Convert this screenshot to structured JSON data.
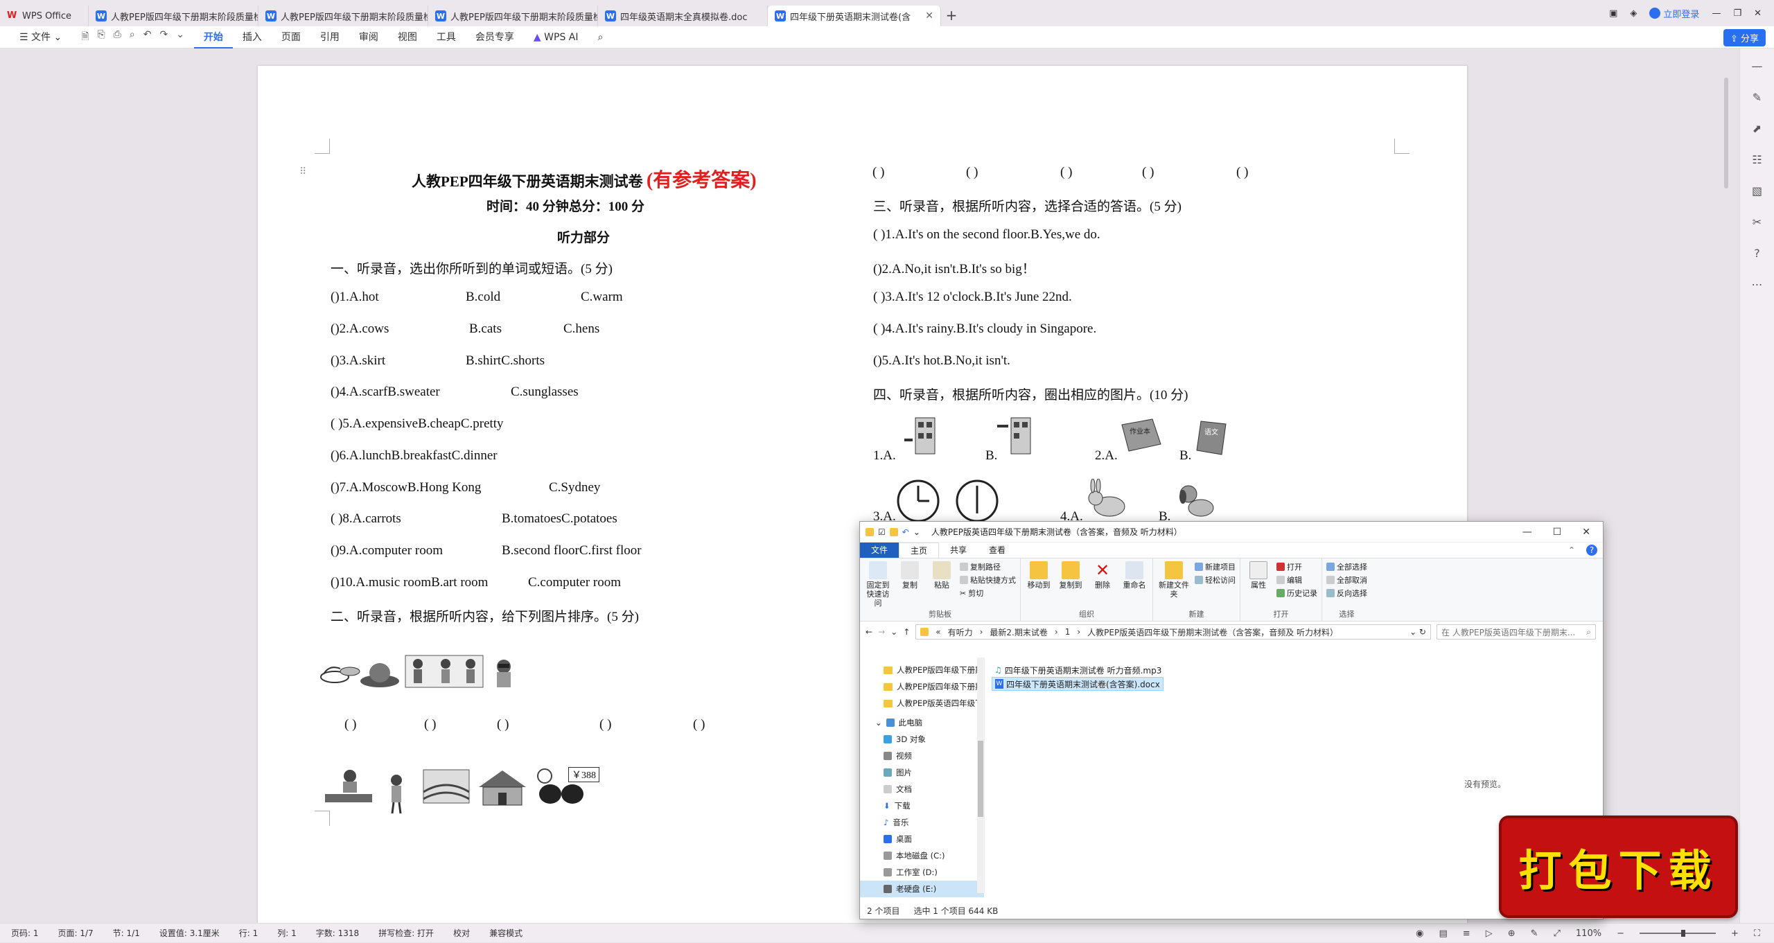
{
  "tabs": [
    {
      "label": "WPS Office",
      "kind": "wps"
    },
    {
      "label": "人教PEP版四年级下册期末阶段质量检",
      "kind": "doc"
    },
    {
      "label": "人教PEP版四年级下册期末阶段质量检",
      "kind": "doc"
    },
    {
      "label": "人教PEP版四年级下册期末阶段质量检",
      "kind": "doc"
    },
    {
      "label": "四年级英语期末全真模拟卷.doc",
      "kind": "doc"
    },
    {
      "label": "四年级下册英语期末测试卷(含",
      "kind": "doc",
      "active": true
    }
  ],
  "titlebar": {
    "login": "立即登录"
  },
  "menu": {
    "file": "文件",
    "items": [
      "开始",
      "插入",
      "页面",
      "引用",
      "审阅",
      "视图",
      "工具",
      "会员专享"
    ],
    "active": "开始",
    "ai": "WPS AI",
    "share": "分享"
  },
  "doc": {
    "title": "人教PEP四年级下册英语期末测试卷",
    "title_red": "(有参考答案)",
    "time": "时间：40 分钟总分：100 分",
    "section": "听力部分",
    "q1_head": "一、听录音，选出你所听到的单词或短语。(5 分)",
    "q1": [
      "()1.A.hot",
      "B.cold",
      "C.warm",
      "()2.A.cows",
      "B.cats",
      "C.hens",
      "()3.A.skirt",
      "B.shirtC.shorts",
      "()4.A.scarfB.sweater",
      "C.sunglasses",
      "(        )5.A.expensiveB.cheapC.pretty",
      "()6.A.lunchB.breakfastC.dinner",
      "()7.A.MoscowB.Hong Kong",
      "C.Sydney",
      "(        )8.A.carrots",
      "B.tomatoesC.potatoes",
      "()9.A.computer room",
      "B.second floorC.first floor",
      "()10.A.music roomB.art room",
      "C.computer room"
    ],
    "q2_head": "二、听录音，根据所听内容，给下列图片排序。(5 分)",
    "paren": "(       )",
    "price": "￥388",
    "q3_head": "三、听录音，根据所听内容，选择合适的答语。(5 分)",
    "q3": [
      "(          )1.A.It's on the second floor.B.Yes,we do.",
      "()2.A.No,it isn't.B.It's so big！",
      "(          )3.A.It's 12 o'clock.B.It's June 22nd.",
      "(          )4.A.It's rainy.B.It's cloudy in Singapore.",
      "()5.A.It's hot.B.No,it isn't."
    ],
    "q4_head": "四、听录音，根据所听内容，圈出相应的图片。(10 分)",
    "q4_labels": [
      "1.A.",
      "B.",
      "2.A.",
      "B.",
      "3.A.",
      "4.A.",
      "B."
    ],
    "book1": "作业本",
    "book2": "语文"
  },
  "explorer": {
    "title": "人教PEP版英语四年级下册期末测试卷（含答案，音频及 听力材料）",
    "tabs": [
      "文件",
      "主页",
      "共享",
      "查看"
    ],
    "ribbon": {
      "pin": "固定到快速访问",
      "copy": "复制",
      "paste": "粘贴",
      "copy_path": "复制路径",
      "paste_shortcut": "粘贴快捷方式",
      "cut": "剪切",
      "clipboard": "剪贴板",
      "move_to": "移动到",
      "copy_to": "复制到",
      "delete": "删除",
      "rename": "重命名",
      "organize": "组织",
      "new_folder": "新建文件夹",
      "new_item": "新建项目",
      "easy_access": "轻松访问",
      "new": "新建",
      "properties": "属性",
      "open": "打开",
      "edit": "编辑",
      "history": "历史记录",
      "open_group": "打开",
      "select_all": "全部选择",
      "select_none": "全部取消",
      "invert": "反向选择",
      "select": "选择"
    },
    "path": [
      "有听力",
      "最新2.期末试卷",
      "1",
      "人教PEP版英语四年级下册期末测试卷（含答案，音频及 听力材料）"
    ],
    "search_placeholder": "在 人教PEP版英语四年级下册期末...",
    "nav": [
      {
        "label": "人教PEP版四年级下册期",
        "type": "folder"
      },
      {
        "label": "人教PEP版四年级下册期",
        "type": "folder"
      },
      {
        "label": "人教PEP版英语四年级下",
        "type": "folder"
      },
      {
        "label": "此电脑",
        "type": "pc"
      },
      {
        "label": "3D 对象",
        "type": "item"
      },
      {
        "label": "视频",
        "type": "item"
      },
      {
        "label": "图片",
        "type": "item"
      },
      {
        "label": "文档",
        "type": "item"
      },
      {
        "label": "下载",
        "type": "item"
      },
      {
        "label": "音乐",
        "type": "item"
      },
      {
        "label": "桌面",
        "type": "item"
      },
      {
        "label": "本地磁盘 (C:)",
        "type": "drive"
      },
      {
        "label": "工作室 (D:)",
        "type": "drive"
      },
      {
        "label": "老硬盘 (E:)",
        "type": "drive"
      }
    ],
    "files": [
      {
        "name": "四年级下册英语期末测试卷 听力音频.mp3",
        "selected": false
      },
      {
        "name": "四年级下册英语期末测试卷(含答案).docx",
        "selected": true
      }
    ],
    "no_preview": "没有预览。",
    "status_count": "2 个项目",
    "status_sel": "选中 1 个项目  644 KB"
  },
  "status": {
    "page_no": "页码: 1",
    "pages": "页面: 1/7",
    "section": "节: 1/1",
    "setting": "设置值: 3.1厘米",
    "row": "行: 1",
    "col": "列: 1",
    "words": "字数: 1318",
    "spell": "拼写检查: 打开",
    "proof": "校对",
    "compat": "兼容模式",
    "zoom": "110%"
  },
  "badge": "打包下载"
}
